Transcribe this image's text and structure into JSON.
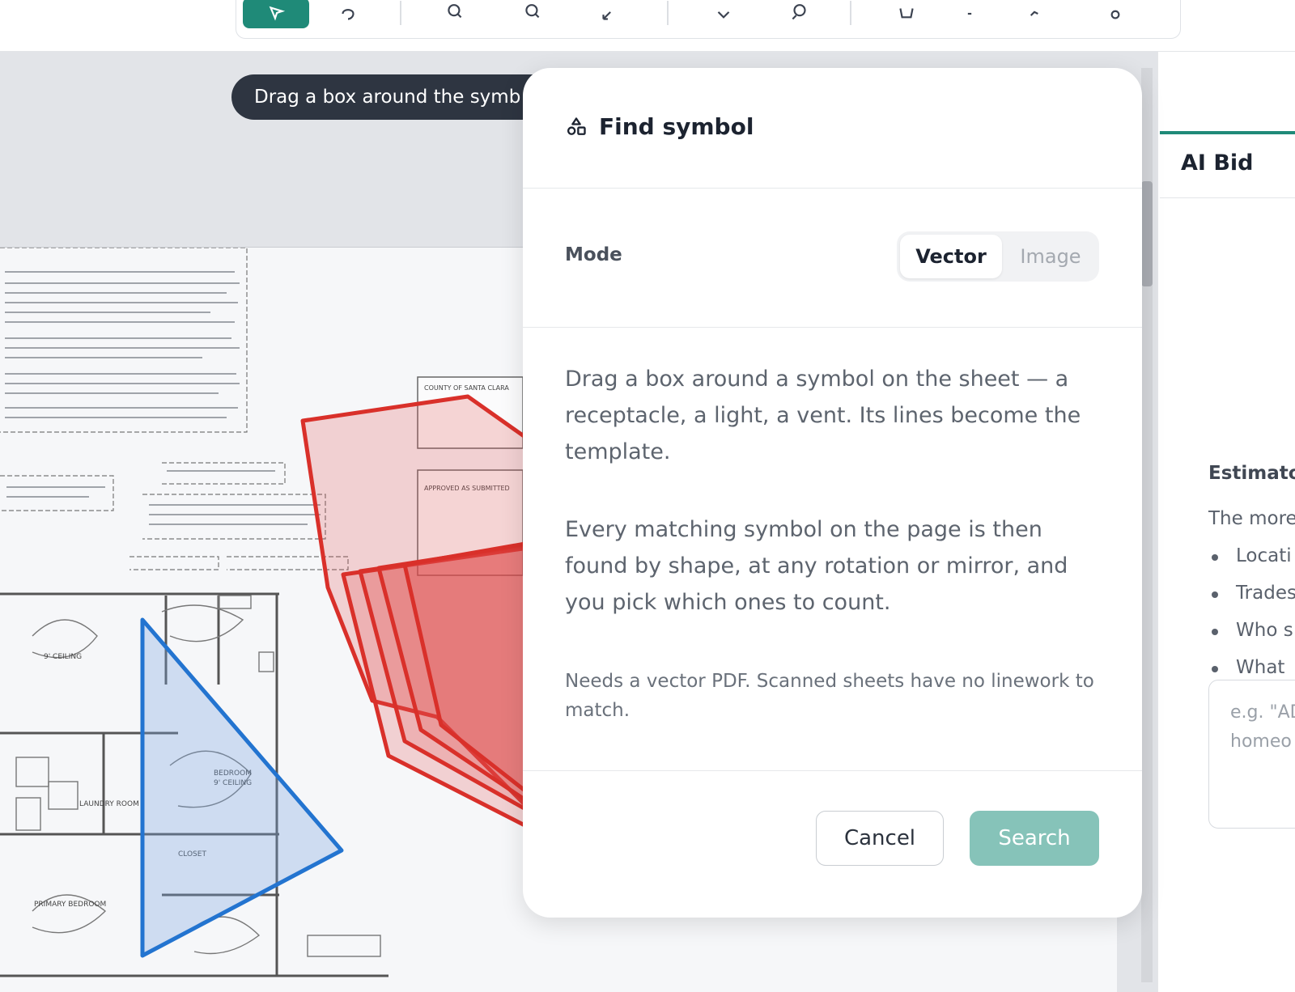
{
  "toolbar": {
    "tools": [
      "select-icon",
      "pan-icon",
      "zoom-in-icon",
      "zoom-out-icon",
      "fit-icon",
      "tag-icon",
      "find-symbol-icon",
      "cart-icon",
      "undo-icon",
      "route-icon",
      "pin-icon"
    ],
    "accent_color": "#1f8a78"
  },
  "canvas": {
    "hint": "Drag a box around the symb"
  },
  "dialog": {
    "title": "Find symbol",
    "mode_label": "Mode",
    "mode_options": [
      "Vector",
      "Image"
    ],
    "mode_selected": "Vector",
    "paragraph1": "Drag a box around a symbol on the sheet — a receptacle, a light, a vent. Its lines become the template.",
    "paragraph2": "Every matching symbol on the page is then found by shape, at any rotation or mirror, and you pick which ones to count.",
    "note": "Needs a vector PDF. Scanned sheets have no linework to match.",
    "cancel_label": "Cancel",
    "search_label": "Search",
    "search_color": "#86c3b9"
  },
  "right_panel": {
    "tab_title": "AI Bid",
    "estimator_heading": "Estimato",
    "intro": "The more",
    "bullets": [
      "Locati",
      "Trades",
      "Who s",
      "What"
    ],
    "textarea_placeholder_line1": "e.g. \"AD",
    "textarea_placeholder_line2": "homeo"
  },
  "sheet": {
    "labels": {
      "ceiling_9": "9' CEILING",
      "bedroom": "BEDROOM",
      "bedroom_ceiling": "9' CEILING",
      "primary_bedroom": "PRIMARY BEDROOM",
      "laundry": "LAUNDRY ROOM",
      "county": "COUNTY OF SANTA CLARA",
      "approved": "APPROVED AS SUBMITTED",
      "closet": "CLOSET"
    }
  }
}
